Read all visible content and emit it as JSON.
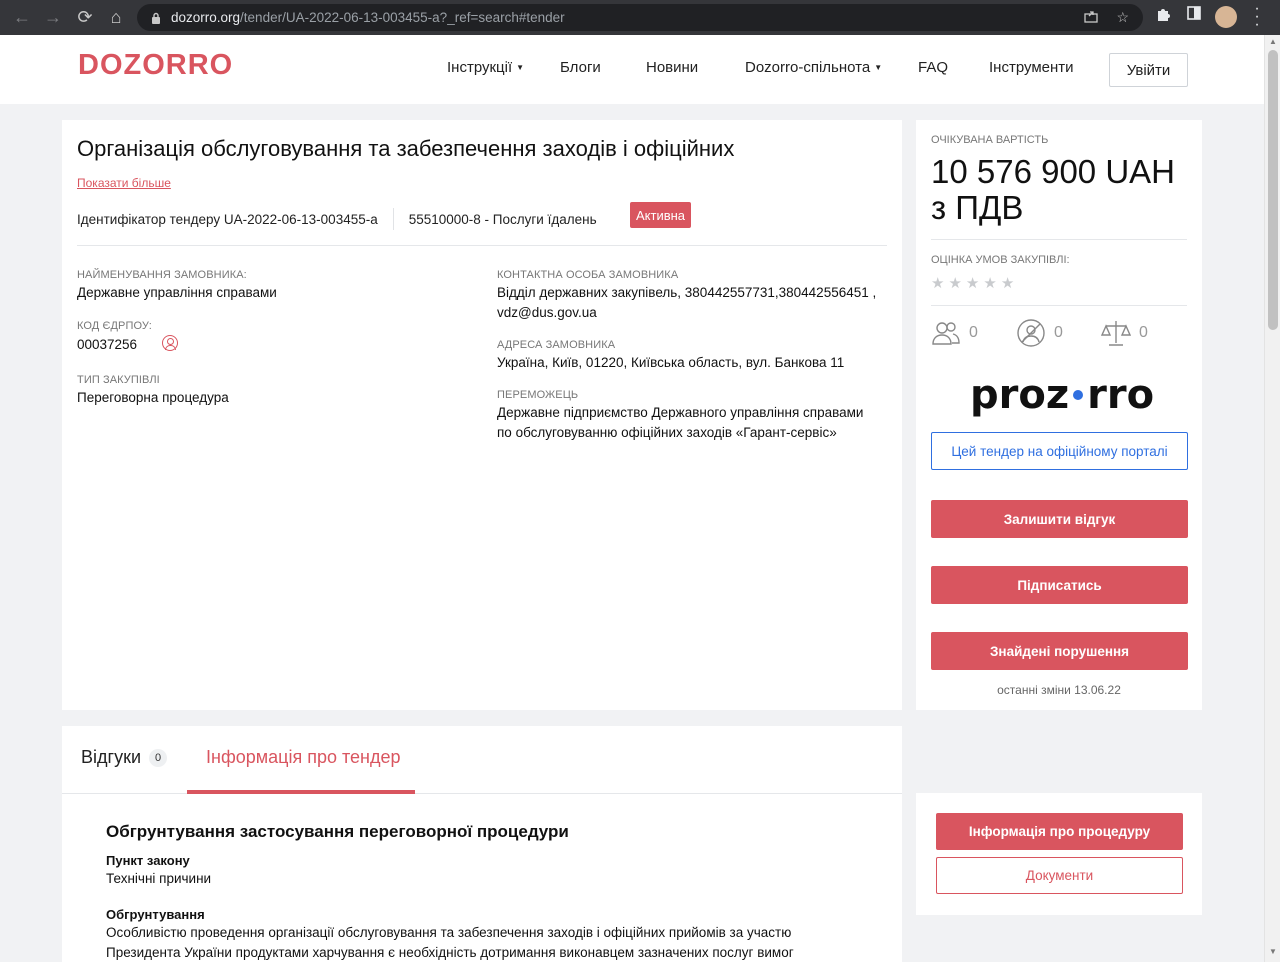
{
  "browser": {
    "url_host": "dozorro.org",
    "url_path": "/tender/UA-2022-06-13-003455-a?_ref=search#tender"
  },
  "header": {
    "logo": "DOZORRO",
    "nav": [
      {
        "label": "Інструкції",
        "dropdown": true
      },
      {
        "label": "Блоги",
        "dropdown": false
      },
      {
        "label": "Новини",
        "dropdown": false
      },
      {
        "label": "Dozorro-спільнота",
        "dropdown": true
      },
      {
        "label": "FAQ",
        "dropdown": false
      },
      {
        "label": "Інструменти",
        "dropdown": false
      }
    ],
    "login_label": "Увійти"
  },
  "tender": {
    "title": "Організація обслуговування та забезпечення заходів і офіційних",
    "show_more": "Показати більше",
    "id_text": "Ідентифікатор тендеру UA-2022-06-13-003455-a",
    "cpv_text": "55510000-8 - Послуги їдалень",
    "status": "Активна",
    "fields_left": [
      {
        "label": "НАЙМЕНУВАННЯ ЗАМОВНИКА:",
        "value": "Державне управління справами"
      },
      {
        "label": "КОД ЄДРПОУ:",
        "value": "00037256"
      },
      {
        "label": "ТИП ЗАКУПІВЛІ",
        "value": "Переговорна процедура"
      }
    ],
    "fields_right": [
      {
        "label": "КОНТАКТНА ОСОБА ЗАМОВНИКА",
        "value_line1": "Відділ державних закупівель, 380442557731,380442556451 ,",
        "value_line2": "vdz@dus.gov.ua"
      },
      {
        "label": "АДРЕСА ЗАМОВНИКА",
        "value_line1": "Україна, Київ, 01220, Київська область, вул. Банкова 11",
        "value_line2": ""
      },
      {
        "label": "ПЕРЕМОЖЕЦЬ",
        "value_line1": "Державне підприємство Державного управління справами",
        "value_line2": "по обслуговуванню офіційних заходів «Гарант-сервіс»"
      }
    ]
  },
  "side": {
    "expected_label": "ОЧІКУВАНА ВАРТІСТЬ",
    "price_line1": "10 576 900 UAH",
    "price_line2": "з ПДВ",
    "rating_label": "ОЦІНКА УМОВ ЗАКУПІВЛІ:",
    "rating": 0,
    "counters": [
      "0",
      "0",
      "0"
    ],
    "prozorro_left": "proz",
    "prozorro_right": "rro",
    "portal_btn": "Цей тендер на офіційному порталі",
    "feedback_btn": "Залишити відгук",
    "subscribe_btn": "Підписатись",
    "violations_btn": "Знайдені порушення",
    "last_change": "останні зміни 13.06.22"
  },
  "tabs": {
    "reviews_label": "Відгуки",
    "reviews_count": "0",
    "info_label": "Інформація про тендер"
  },
  "justification": {
    "title": "Обгрунтування застосування переговорної процедури",
    "law_label": "Пункт закону",
    "law_value": "Технічні причини",
    "reason_label": "Обгрунтування",
    "reason_line1": "Особливістю проведення організації обслуговування та забезпечення заходів і офіційних прийомів за участю",
    "reason_line2": "Президента України продуктами харчування є необхідність дотримання виконавцем зазначених послуг вимог"
  },
  "procedure": {
    "info_btn": "Інформація про процедуру",
    "docs_btn": "Документи"
  },
  "colors": {
    "accent": "#d9555f",
    "link_blue": "#2f6fe0"
  }
}
